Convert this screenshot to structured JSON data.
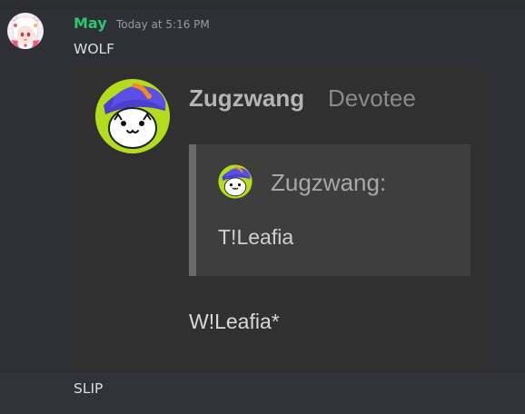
{
  "message": {
    "author": "May",
    "author_color": "#2dc770",
    "timestamp": "Today at 5:16 PM",
    "lines": [
      "WOLF",
      "SLIP"
    ]
  },
  "attachment": {
    "author": "Zugzwang",
    "role": "Devotee",
    "quote": {
      "author": "Zugzwang:",
      "text": "T!Leafia"
    },
    "reply": "W!Leafia*"
  },
  "colors": {
    "background": "#313338",
    "text": "#dbdee1",
    "muted": "#949ba4"
  },
  "icons": {
    "user_avatar": "anime-girl-avatar",
    "attachment_avatar": "cat-with-cap-avatar"
  }
}
